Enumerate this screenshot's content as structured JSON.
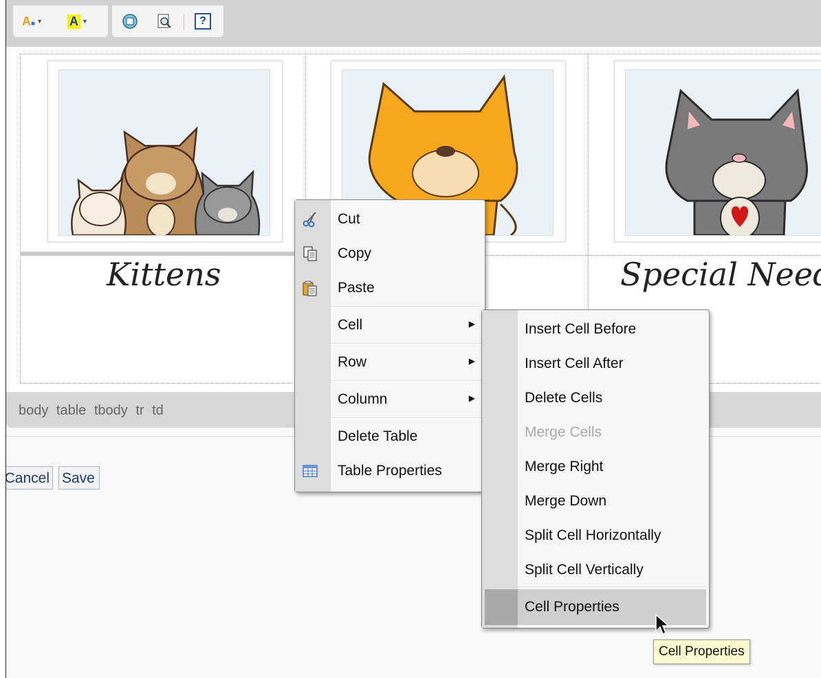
{
  "toolbar": {
    "buttons": [
      {
        "name": "text-color-button",
        "icon": "text-color-icon"
      },
      {
        "name": "background-color-button",
        "icon": "highlight-color-icon"
      },
      {
        "name": "maximize-button",
        "icon": "maximize-icon"
      },
      {
        "name": "preview-button",
        "icon": "preview-icon"
      },
      {
        "name": "help-button",
        "icon": "help-icon",
        "glyph": "?"
      }
    ]
  },
  "content": {
    "cells": [
      {
        "caption": "Kittens",
        "image": "kittens-image"
      },
      {
        "caption": "",
        "image": "orange-cat-image"
      },
      {
        "caption": "Special Needs",
        "image": "gray-cat-heart-image"
      }
    ]
  },
  "statusbar": {
    "path": "body table tbody tr td"
  },
  "actions": {
    "cancel_label": "Cancel",
    "save_label": "Save"
  },
  "context_menu": {
    "items": [
      {
        "label": "Cut",
        "icon": "scissors-icon"
      },
      {
        "label": "Copy",
        "icon": "copy-icon"
      },
      {
        "label": "Paste",
        "icon": "paste-icon"
      },
      {
        "label": "Cell",
        "submenu": true
      },
      {
        "label": "Row",
        "submenu": true
      },
      {
        "label": "Column",
        "submenu": true
      },
      {
        "label": "Delete Table"
      },
      {
        "label": "Table Properties",
        "icon": "table-icon"
      }
    ]
  },
  "cell_submenu": {
    "items": [
      {
        "label": "Insert Cell Before",
        "enabled": true
      },
      {
        "label": "Insert Cell After",
        "enabled": true
      },
      {
        "label": "Delete Cells",
        "enabled": true
      },
      {
        "label": "Merge Cells",
        "enabled": false
      },
      {
        "label": "Merge Right",
        "enabled": true
      },
      {
        "label": "Merge Down",
        "enabled": true
      },
      {
        "label": "Split Cell Horizontally",
        "enabled": true
      },
      {
        "label": "Split Cell Vertically",
        "enabled": true
      },
      {
        "label": "Cell Properties",
        "enabled": true,
        "highlighted": true
      }
    ]
  },
  "tooltip": {
    "text": "Cell Properties"
  }
}
